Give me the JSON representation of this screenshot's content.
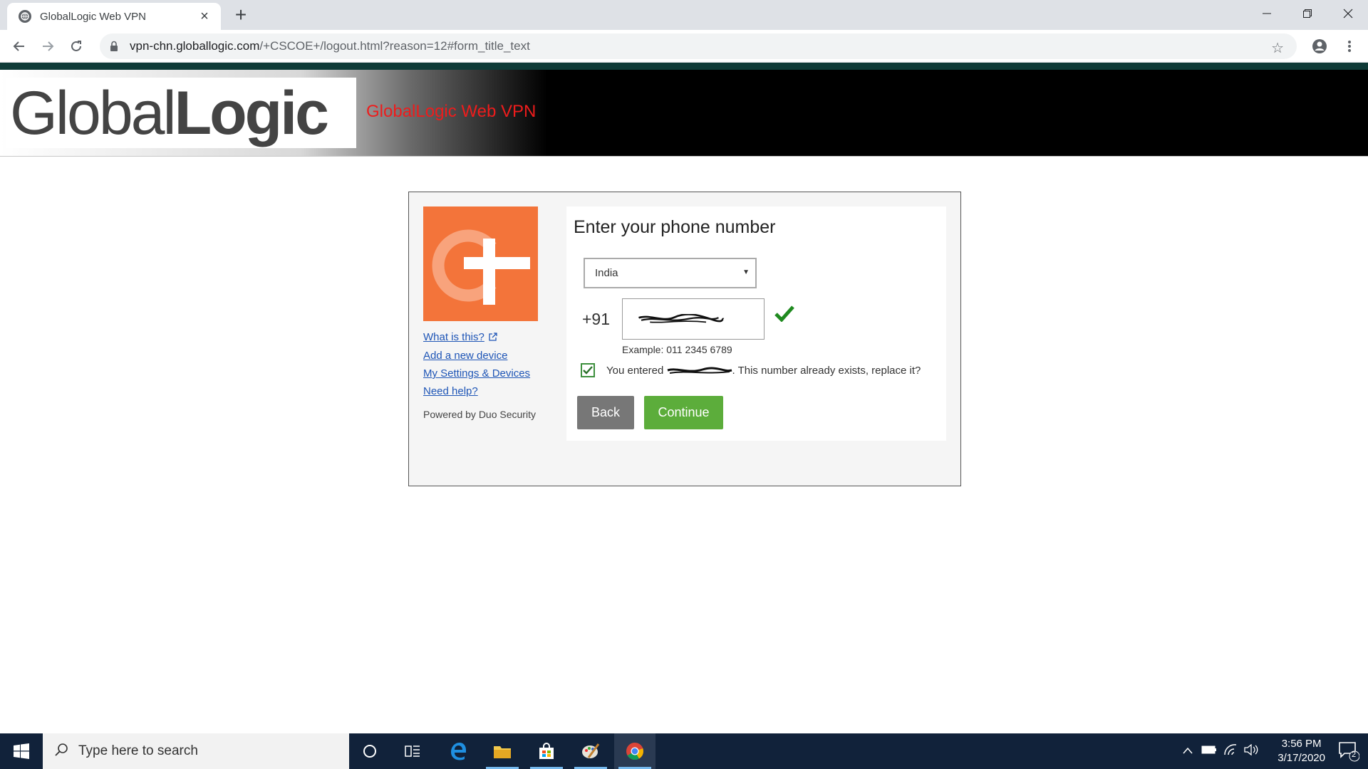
{
  "browser": {
    "tab_title": "GlobalLogic Web VPN",
    "url_host": "vpn-chn.globallogic.com",
    "url_path": "/+CSCOE+/logout.html?reason=12#form_title_text"
  },
  "header": {
    "logo_text_light": "Global",
    "logo_text_bold": "Logic",
    "vpn_title": "GlobalLogic Web VPN"
  },
  "duo": {
    "links": {
      "what_is_this": "What is this?",
      "add_device": "Add a new device",
      "settings": "My Settings & Devices",
      "need_help": "Need help?"
    },
    "powered_by": "Powered by Duo Security",
    "title": "Enter your phone number",
    "country": "India",
    "dial_code": "+91",
    "example": "Example: 011 2345 6789",
    "replace_prefix": "You entered",
    "replace_suffix": ". This number already exists, replace it?",
    "replace_checked": true,
    "back_label": "Back",
    "continue_label": "Continue",
    "brand_color": "#f3743a",
    "continue_color": "#5cad3b"
  },
  "taskbar": {
    "search_placeholder": "Type here to search",
    "time": "3:56 PM",
    "date": "3/17/2020",
    "notification_count": "2"
  }
}
